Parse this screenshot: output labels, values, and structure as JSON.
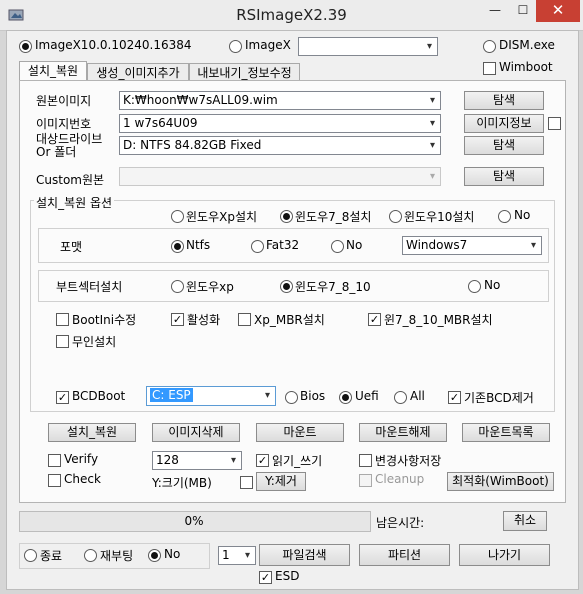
{
  "window": {
    "title": "RSImageX2.39",
    "min": "—",
    "max": "☐",
    "close": "✕"
  },
  "top_radios": {
    "imagex10": "ImageX10.0.10240.16384",
    "imagex": "ImageX",
    "imagex_combo_value": "",
    "dism": "DISM.exe",
    "wimboot": "Wimboot"
  },
  "tabs": [
    "설치_복원",
    "생성_이미지추가",
    "내보내기_정보수정"
  ],
  "fields": {
    "source_label": "원본이미지",
    "source_value": "K:₩hoon₩w7sALL09.wim",
    "source_btn": "탐색",
    "index_label": "이미지번호",
    "index_value": "1  w7s64U09",
    "index_btn": "이미지정보",
    "target_label_1": "대상드라이브",
    "target_label_2": "Or 폴더",
    "target_value": "D:  NTFS              84.82GB  Fixed",
    "target_btn": "탐색",
    "custom_label": "Custom원본",
    "custom_value": "",
    "custom_btn": "탐색"
  },
  "options": {
    "group_title": "설치_복원 옵션",
    "os_radios": [
      "윈도우Xp설치",
      "윈도우7_8설치",
      "윈도우10설치",
      "No"
    ],
    "os_selected": 1,
    "format_label": "포맷",
    "format_radios": [
      "Ntfs",
      "Fat32",
      "No"
    ],
    "format_selected": 0,
    "format_combo": "Windows7",
    "boot_label": "부트섹터설치",
    "boot_radios": [
      "윈도우xp",
      "윈도우7_8_10",
      "No"
    ],
    "boot_selected": 1,
    "checks_row1": [
      {
        "label": "BootIni수정",
        "checked": false
      },
      {
        "label": "활성화",
        "checked": true
      },
      {
        "label": "Xp_MBR설치",
        "checked": false
      },
      {
        "label": "윈7_8_10_MBR설치",
        "checked": true
      }
    ],
    "unattended": {
      "label": "무인설치",
      "checked": false
    },
    "bcdboot": {
      "label": "BCDBoot",
      "checked": true,
      "combo": "C: ESP"
    },
    "bcd_radios": [
      "Bios",
      "Uefi",
      "All"
    ],
    "bcd_selected": 1,
    "bcd_remove": {
      "label": "기존BCD제거",
      "checked": true
    }
  },
  "actions": [
    "설치_복원",
    "이미지삭제",
    "마운트",
    "마운트해제",
    "마운트목록"
  ],
  "lower": {
    "verify": "Verify",
    "check": "Check",
    "size_combo": "128",
    "size_label": "Y:크기(MB)",
    "readwrite": "읽기_쓰기",
    "y_remove": "Y:제거",
    "save_changes": "변경사항저장",
    "cleanup": "Cleanup",
    "optimize": "최적화(WimBoot)"
  },
  "progress": {
    "percent": "0%",
    "value": 0,
    "remaining": "남은시간:",
    "cancel": "취소"
  },
  "bottom": {
    "radios": [
      "종료",
      "재부팅",
      "No"
    ],
    "selected": 2,
    "count_combo": "1",
    "search": "파일검색",
    "partition": "파티션",
    "exit": "나가기",
    "esd": "ESD"
  }
}
